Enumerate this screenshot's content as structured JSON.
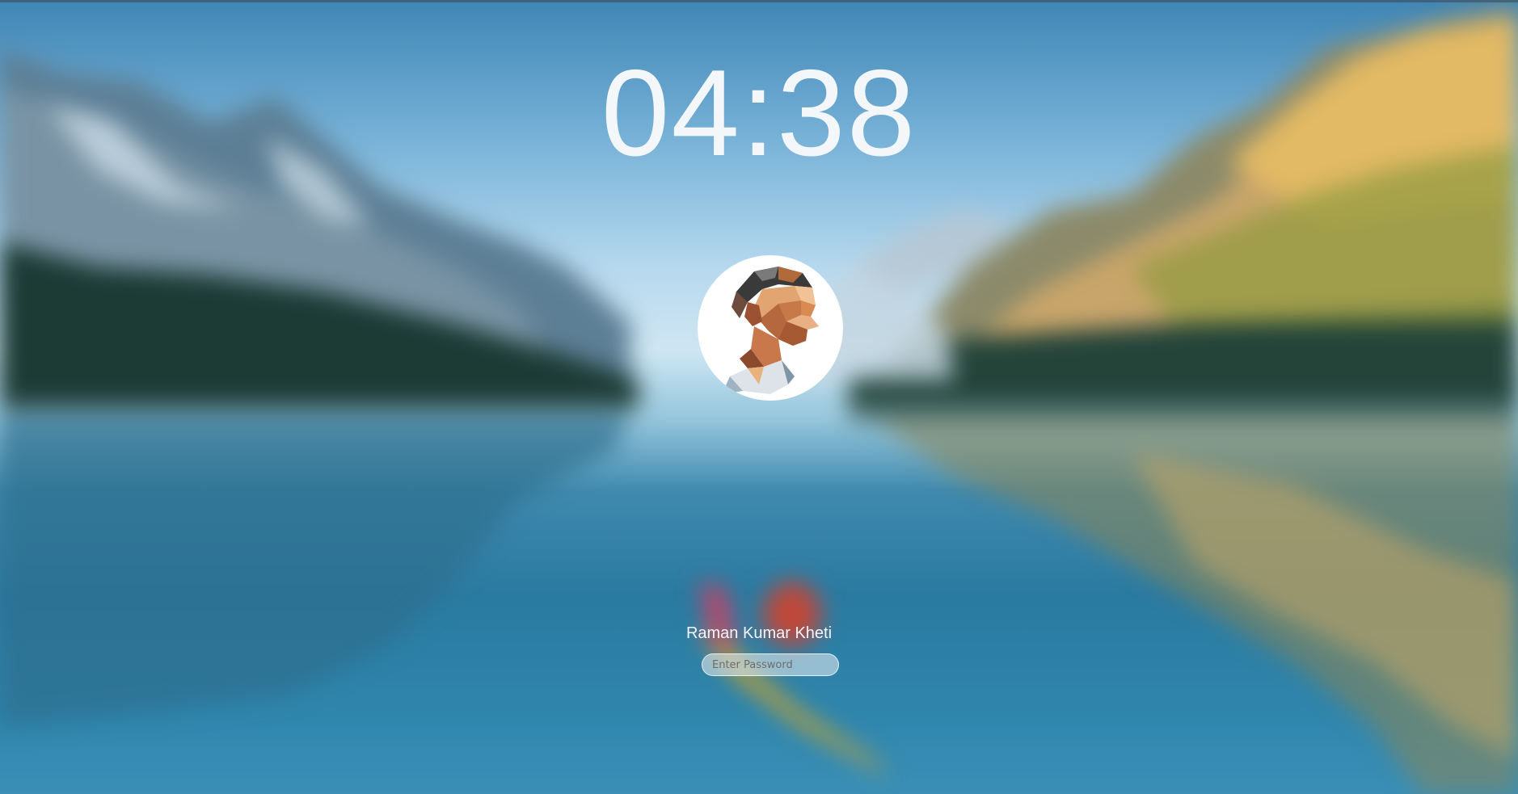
{
  "lock_screen": {
    "time": "04:38",
    "user": {
      "name": "Raman Kumar Kheti",
      "avatar_icon": "low-poly-portrait-icon"
    },
    "password_field": {
      "value": "",
      "placeholder": "Enter Password"
    }
  },
  "colors": {
    "sky": "#79b3d8",
    "lake": "#2a7aa1",
    "text": "#f4f7fa"
  }
}
